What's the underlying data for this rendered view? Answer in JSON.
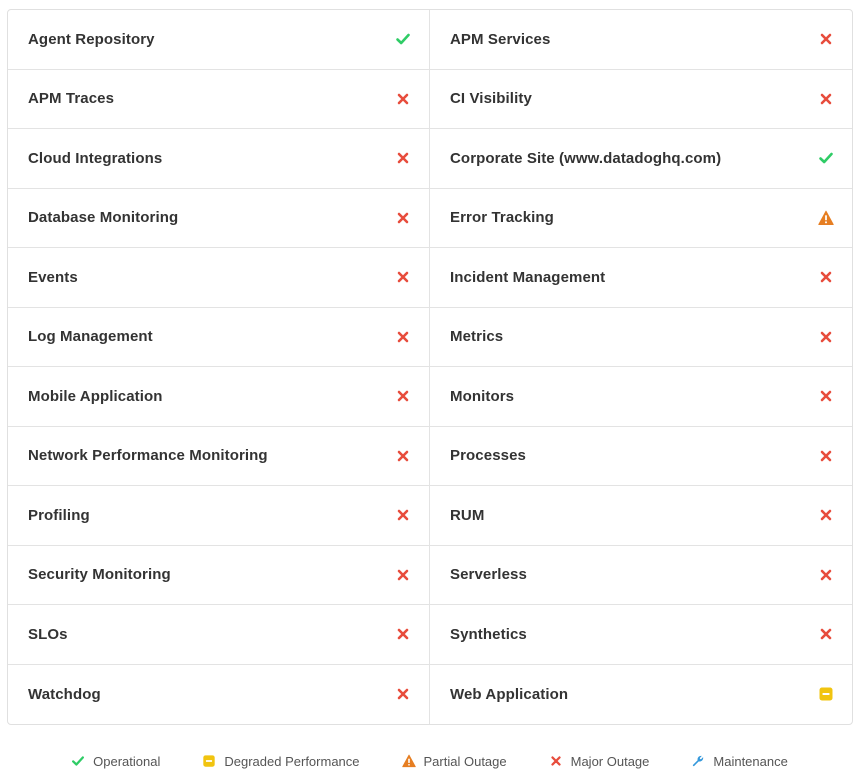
{
  "colors": {
    "operational": "#2fcc66",
    "degraded": "#f1c40f",
    "partial": "#e67e22",
    "major": "#e74c3c",
    "maintenance": "#3498db"
  },
  "components": [
    {
      "name": "Agent Repository",
      "status": "operational"
    },
    {
      "name": "APM Services",
      "status": "major"
    },
    {
      "name": "APM Traces",
      "status": "major"
    },
    {
      "name": "CI Visibility",
      "status": "major"
    },
    {
      "name": "Cloud Integrations",
      "status": "major"
    },
    {
      "name": "Corporate Site (www.datadoghq.com)",
      "status": "operational"
    },
    {
      "name": "Database Monitoring",
      "status": "major"
    },
    {
      "name": "Error Tracking",
      "status": "partial"
    },
    {
      "name": "Events",
      "status": "major"
    },
    {
      "name": "Incident Management",
      "status": "major"
    },
    {
      "name": "Log Management",
      "status": "major"
    },
    {
      "name": "Metrics",
      "status": "major"
    },
    {
      "name": "Mobile Application",
      "status": "major"
    },
    {
      "name": "Monitors",
      "status": "major"
    },
    {
      "name": "Network Performance Monitoring",
      "status": "major"
    },
    {
      "name": "Processes",
      "status": "major"
    },
    {
      "name": "Profiling",
      "status": "major"
    },
    {
      "name": "RUM",
      "status": "major"
    },
    {
      "name": "Security Monitoring",
      "status": "major"
    },
    {
      "name": "Serverless",
      "status": "major"
    },
    {
      "name": "SLOs",
      "status": "major"
    },
    {
      "name": "Synthetics",
      "status": "major"
    },
    {
      "name": "Watchdog",
      "status": "major"
    },
    {
      "name": "Web Application",
      "status": "degraded"
    }
  ],
  "legend": [
    {
      "status": "operational",
      "label": "Operational",
      "icon": "check-icon"
    },
    {
      "status": "degraded",
      "label": "Degraded Performance",
      "icon": "minus-square-icon"
    },
    {
      "status": "partial",
      "label": "Partial Outage",
      "icon": "warning-triangle-icon"
    },
    {
      "status": "major",
      "label": "Major Outage",
      "icon": "x-icon"
    },
    {
      "status": "maintenance",
      "label": "Maintenance",
      "icon": "wrench-icon"
    }
  ]
}
